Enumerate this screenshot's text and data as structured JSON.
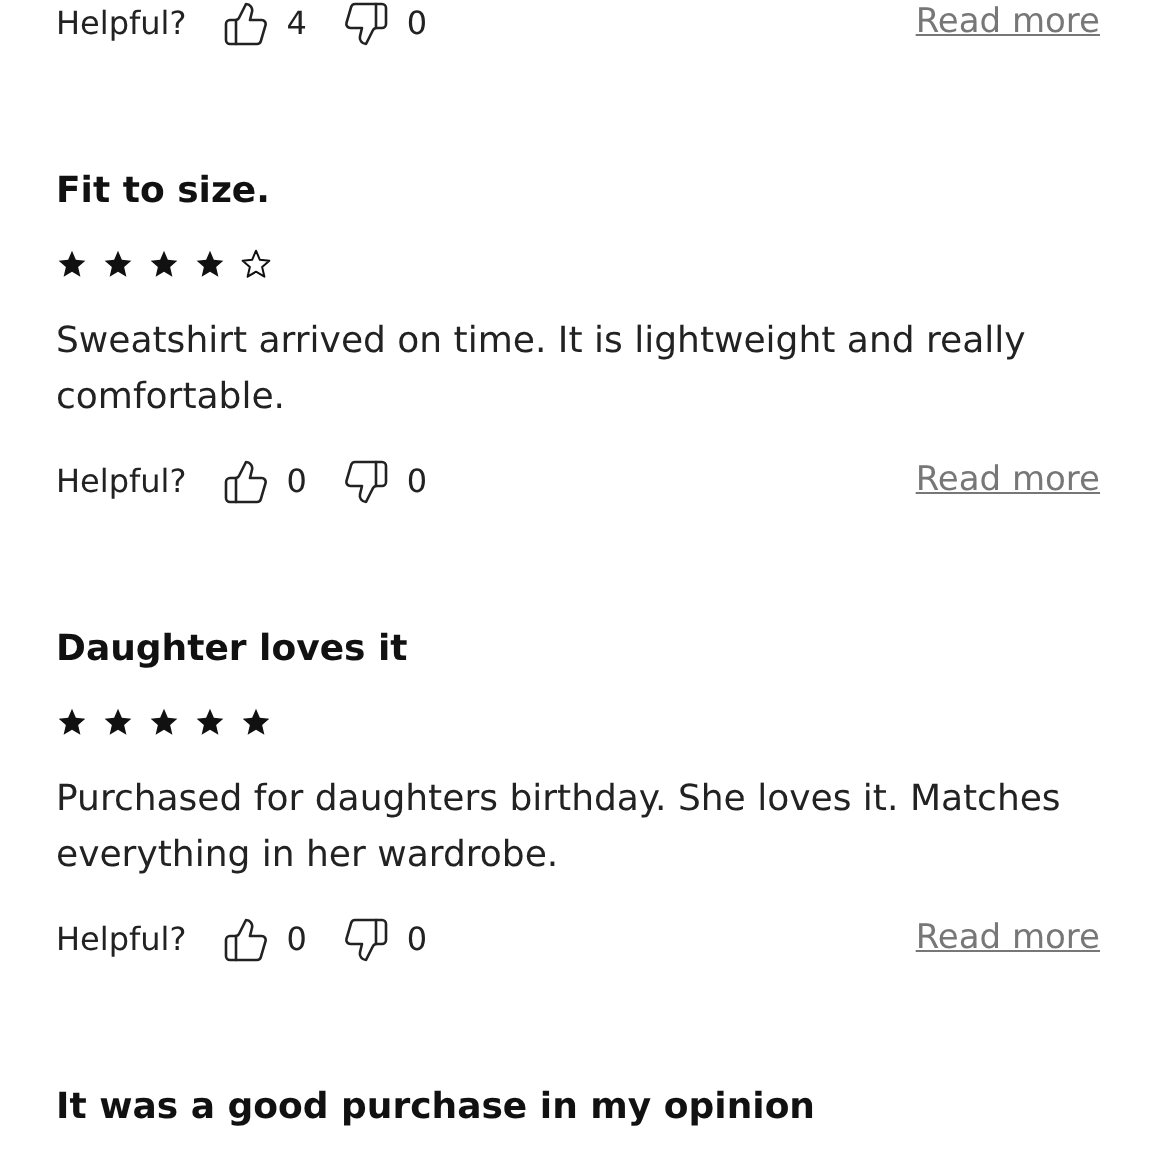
{
  "top_row": {
    "helpful_label": "Helpful?",
    "up_count": "4",
    "down_count": "0",
    "read_more": "Read more"
  },
  "reviews": [
    {
      "title": "Fit to size.",
      "stars": 4,
      "body": "Sweatshirt arrived on time. It is lightweight and really comfortable.",
      "helpful_label": "Helpful?",
      "up_count": "0",
      "down_count": "0",
      "read_more": "Read more"
    },
    {
      "title": "Daughter loves it",
      "stars": 5,
      "body": "Purchased for daughters birthday. She loves it. Matches everything in her wardrobe.",
      "helpful_label": "Helpful?",
      "up_count": "0",
      "down_count": "0",
      "read_more": "Read more"
    },
    {
      "title": "It was a good purchase in my opinion"
    }
  ]
}
